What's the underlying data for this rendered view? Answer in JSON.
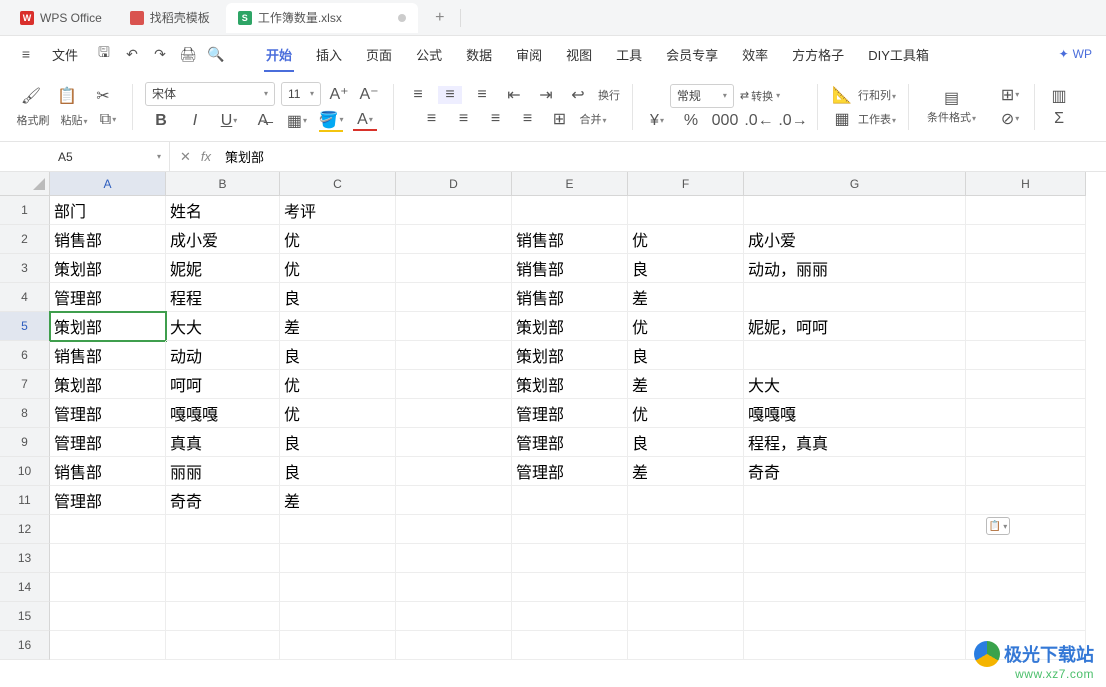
{
  "topbar": {
    "app_name": "WPS Office",
    "template_tab": "找稻壳模板",
    "file_tab": "工作簿数量.xlsx",
    "add_label": "+"
  },
  "menu": {
    "hamburger": "≡",
    "file": "文件",
    "items": [
      "开始",
      "插入",
      "页面",
      "公式",
      "数据",
      "审阅",
      "视图",
      "工具",
      "会员专享",
      "效率",
      "方方格子",
      "DIY工具箱"
    ],
    "active_index": 0,
    "brand": "WP"
  },
  "ribbon": {
    "format_painter": "格式刷",
    "paste": "粘贴",
    "font_name": "宋体",
    "font_size": "11",
    "wrap": "换行",
    "merge": "合并",
    "numfmt": "常规",
    "convert": "转换",
    "rowscols": "行和列",
    "worksheet": "工作表",
    "cond_format": "条件格式"
  },
  "formula": {
    "namebox": "A5",
    "fx": "fx",
    "value": "策划部"
  },
  "columns": [
    "A",
    "B",
    "C",
    "D",
    "E",
    "F",
    "G",
    "H"
  ],
  "selected_col": "A",
  "selected_row": 5,
  "cells": {
    "1": {
      "A": "部门",
      "B": "姓名",
      "C": "考评",
      "D": "",
      "E": "",
      "F": "",
      "G": "",
      "H": ""
    },
    "2": {
      "A": "销售部",
      "B": "成小爱",
      "C": "优",
      "D": "",
      "E": "销售部",
      "F": "优",
      "G": "成小爱",
      "H": ""
    },
    "3": {
      "A": "策划部",
      "B": "妮妮",
      "C": "优",
      "D": "",
      "E": "销售部",
      "F": "良",
      "G": "动动，丽丽",
      "H": ""
    },
    "4": {
      "A": "管理部",
      "B": "程程",
      "C": "良",
      "D": "",
      "E": "销售部",
      "F": "差",
      "G": "",
      "H": ""
    },
    "5": {
      "A": "策划部",
      "B": "大大",
      "C": "差",
      "D": "",
      "E": "策划部",
      "F": "优",
      "G": "妮妮，呵呵",
      "H": ""
    },
    "6": {
      "A": "销售部",
      "B": "动动",
      "C": "良",
      "D": "",
      "E": "策划部",
      "F": "良",
      "G": "",
      "H": ""
    },
    "7": {
      "A": "策划部",
      "B": "呵呵",
      "C": "优",
      "D": "",
      "E": "策划部",
      "F": "差",
      "G": "大大",
      "H": ""
    },
    "8": {
      "A": "管理部",
      "B": "嘎嘎嘎",
      "C": "优",
      "D": "",
      "E": "管理部",
      "F": "优",
      "G": "嘎嘎嘎",
      "H": ""
    },
    "9": {
      "A": "管理部",
      "B": "真真",
      "C": "良",
      "D": "",
      "E": "管理部",
      "F": "良",
      "G": "程程，真真",
      "H": ""
    },
    "10": {
      "A": "销售部",
      "B": "丽丽",
      "C": "良",
      "D": "",
      "E": "管理部",
      "F": "差",
      "G": "奇奇",
      "H": ""
    },
    "11": {
      "A": "管理部",
      "B": "奇奇",
      "C": "差",
      "D": "",
      "E": "",
      "F": "",
      "G": "",
      "H": ""
    },
    "12": {
      "A": "",
      "B": "",
      "C": "",
      "D": "",
      "E": "",
      "F": "",
      "G": "",
      "H": ""
    },
    "13": {
      "A": "",
      "B": "",
      "C": "",
      "D": "",
      "E": "",
      "F": "",
      "G": "",
      "H": ""
    },
    "14": {
      "A": "",
      "B": "",
      "C": "",
      "D": "",
      "E": "",
      "F": "",
      "G": "",
      "H": ""
    },
    "15": {
      "A": "",
      "B": "",
      "C": "",
      "D": "",
      "E": "",
      "F": "",
      "G": "",
      "H": ""
    },
    "16": {
      "A": "",
      "B": "",
      "C": "",
      "D": "",
      "E": "",
      "F": "",
      "G": "",
      "H": ""
    }
  },
  "watermark": {
    "line1": "极光下载站",
    "line2": "www.xz7.com"
  }
}
